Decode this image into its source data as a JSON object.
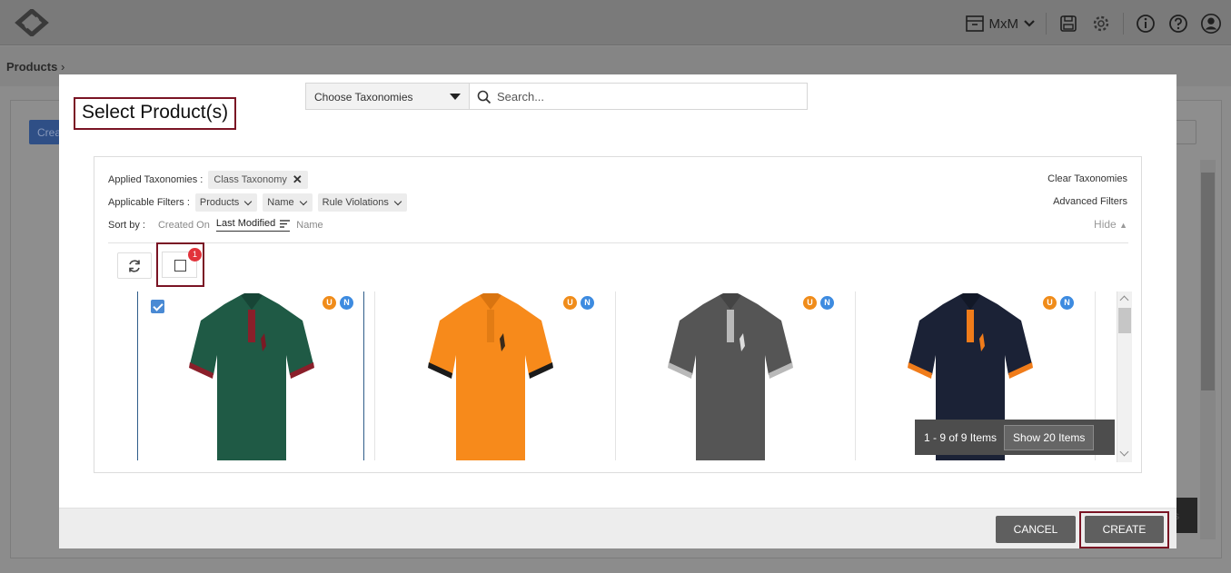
{
  "header": {
    "workspace": "MxM",
    "icons": [
      "archive-icon",
      "save-icon",
      "settings-icon",
      "info-icon",
      "help-icon",
      "user-icon"
    ]
  },
  "breadcrumb": {
    "label": "Products"
  },
  "background": {
    "create_btn_partial": "Crea",
    "dark_btn_partial": "s"
  },
  "modal": {
    "title": "Select Product(s)",
    "taxonomy_select": {
      "value": "Choose Taxonomies"
    },
    "search": {
      "placeholder": "Search..."
    },
    "applied_taxonomies_label": "Applied Taxonomies :",
    "applied_taxonomy_chip": "Class Taxonomy",
    "clear_taxonomies": "Clear Taxonomies",
    "applicable_filters_label": "Applicable Filters :",
    "filters": [
      "Products",
      "Name",
      "Rule Violations"
    ],
    "advanced_filters": "Advanced Filters",
    "sort_label": "Sort by :",
    "sort_options": [
      "Created On",
      "Last Modified",
      "Name"
    ],
    "active_sort": "Last Modified",
    "hide_label": "Hide",
    "selected_count": "1",
    "products": [
      {
        "selected": true,
        "color": "#1f5a45",
        "trim": "#8a1f2a",
        "badges": [
          "U",
          "N"
        ]
      },
      {
        "selected": false,
        "color": "#f78a1b",
        "trim": "#1b1b1b",
        "badges": [
          "U",
          "N"
        ]
      },
      {
        "selected": false,
        "color": "#555555",
        "trim": "#b9b9b9",
        "badges": [
          "U",
          "N"
        ]
      },
      {
        "selected": false,
        "color": "#1b2236",
        "trim": "#f07c1a",
        "badges": [
          "U",
          "N"
        ]
      }
    ],
    "pager": {
      "info": "1 - 9 of 9 Items",
      "show": "Show 20 Items"
    },
    "footer": {
      "cancel": "CANCEL",
      "create": "CREATE"
    }
  },
  "colors": {
    "accent_outline": "#7a1424",
    "badge_red": "#e2333b",
    "badge_u": "#f08c1a",
    "badge_n": "#3d8be0",
    "checkbox": "#4a8ad4"
  }
}
